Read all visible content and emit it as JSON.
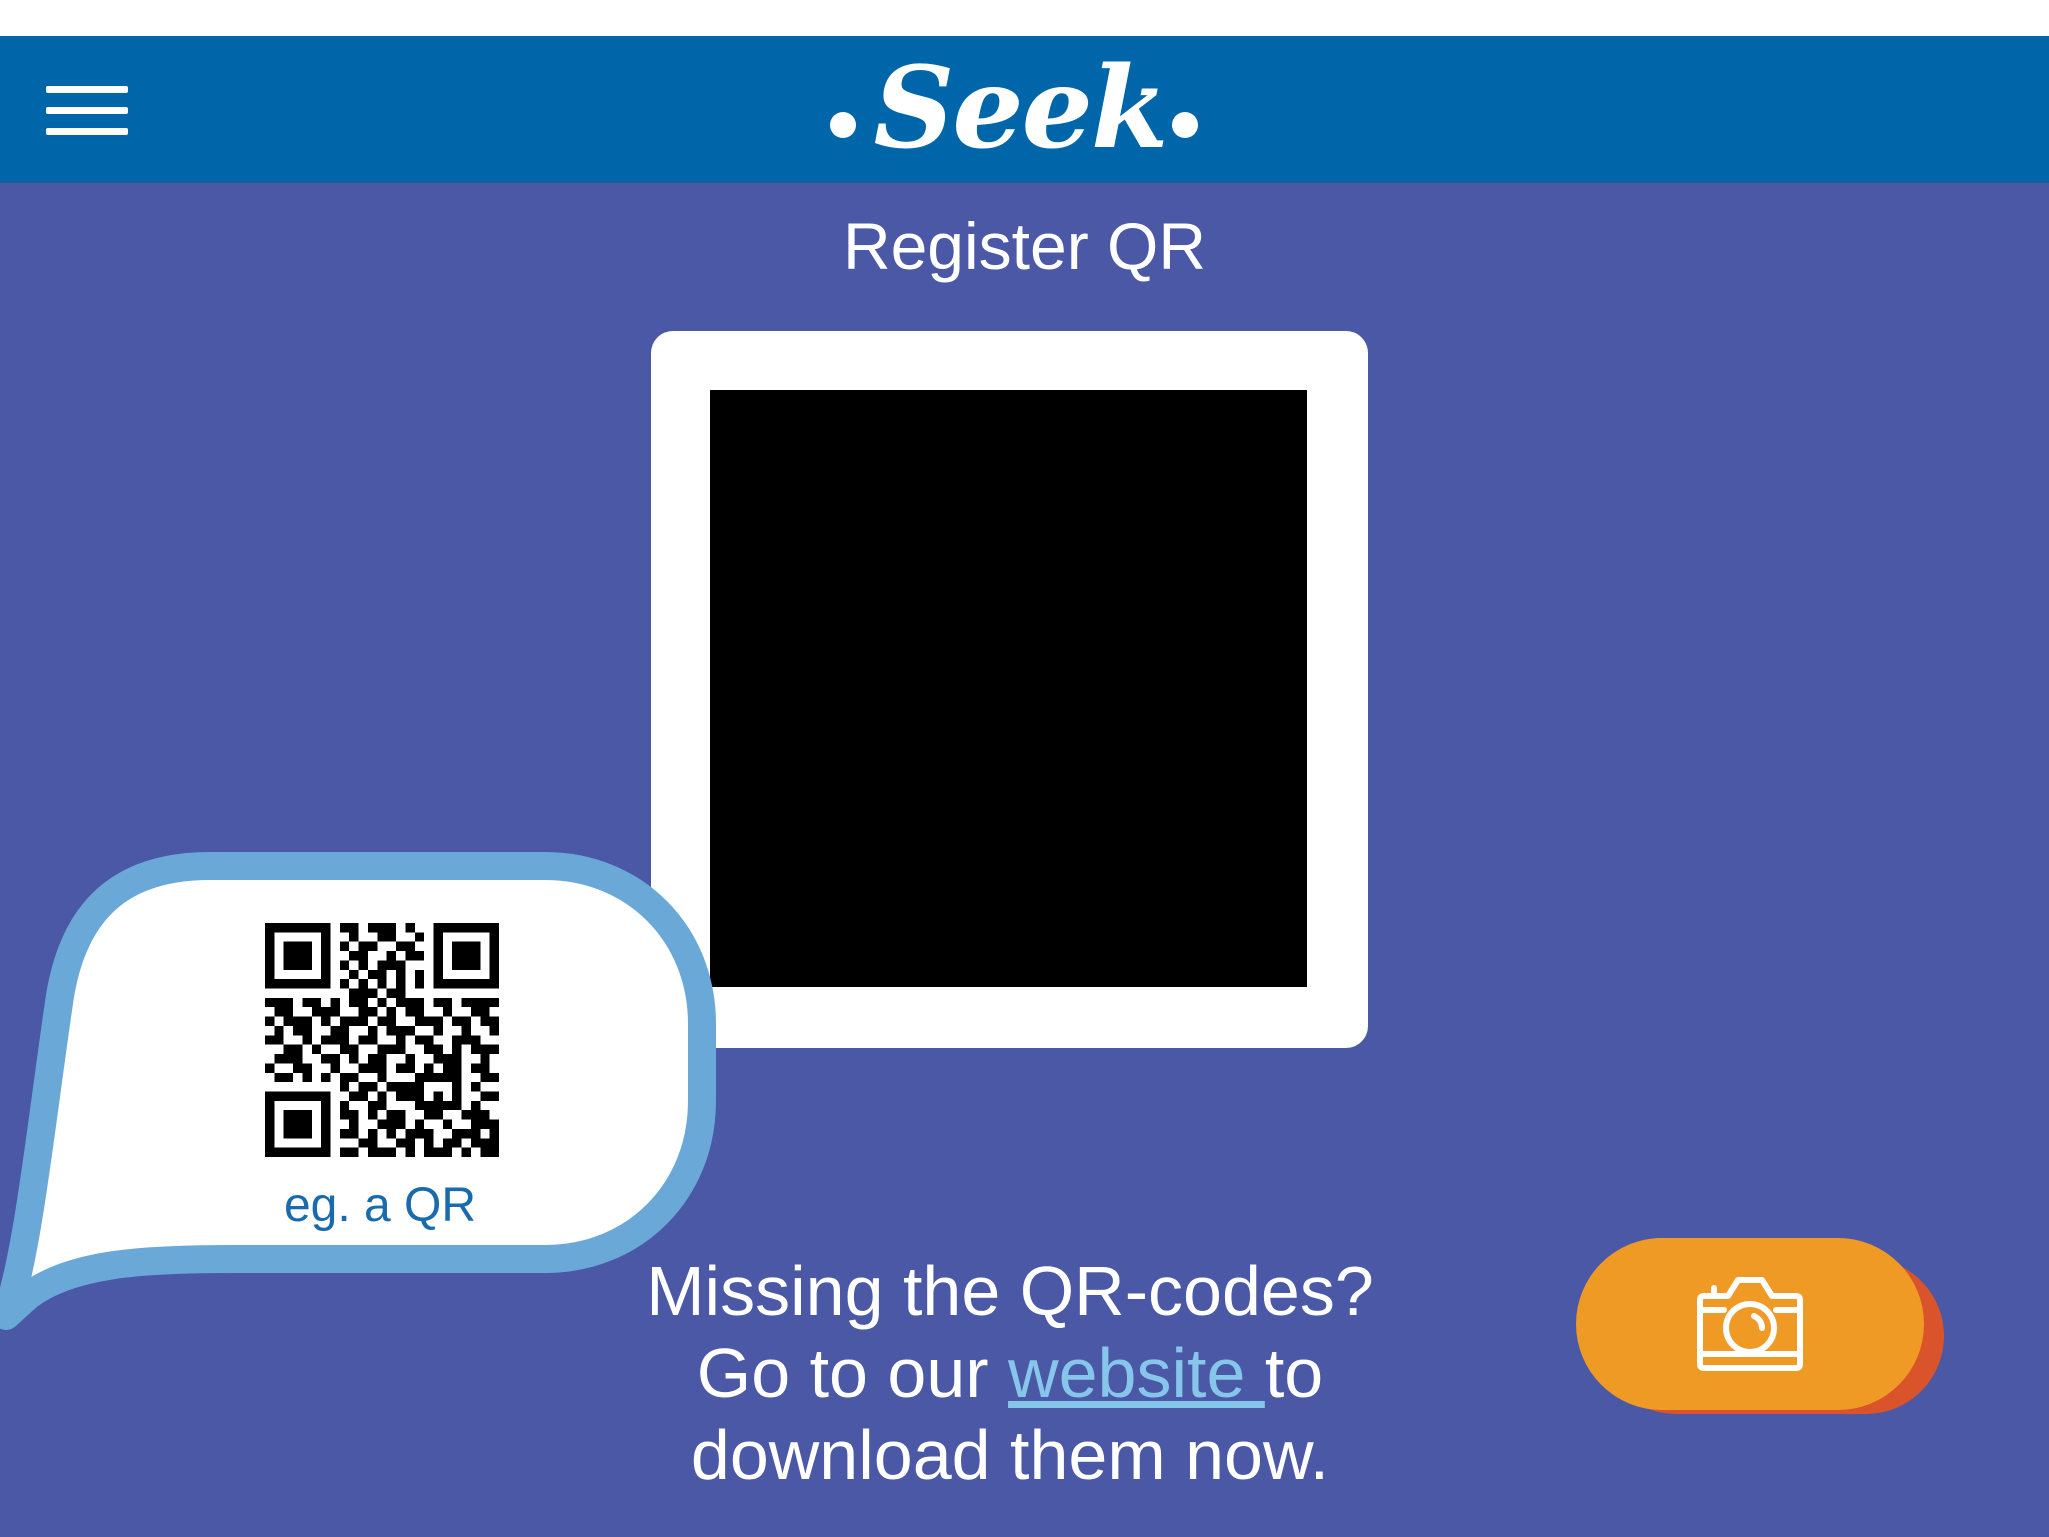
{
  "header": {
    "logo_text": "Seek",
    "menu_icon": "hamburger-menu-icon"
  },
  "page": {
    "title": "Register QR"
  },
  "example_bubble": {
    "caption": "eg. a QR",
    "icon": "qr-code-icon"
  },
  "message": {
    "line1": "Missing the QR-codes?",
    "line2_before": "Go to our ",
    "link_text": "website ",
    "line2_after": "to",
    "line3": "download them now."
  },
  "capture_button": {
    "icon": "camera-icon"
  },
  "colors": {
    "header": "#0066aa",
    "background": "#4b58a5",
    "bubble_border": "#6aa8d8",
    "button": "#f09a26",
    "button_shadow": "#d9542a",
    "link": "#86c6ea"
  }
}
